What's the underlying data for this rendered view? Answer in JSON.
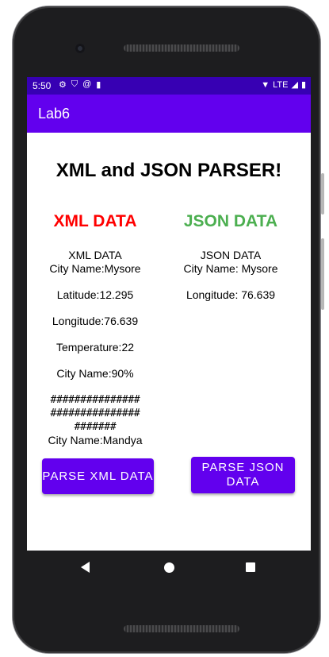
{
  "status_bar": {
    "time": "5:50",
    "network": "LTE"
  },
  "app_bar": {
    "title": "Lab6"
  },
  "main": {
    "title": "XML and JSON PARSER!",
    "xml": {
      "heading": "XML DATA",
      "heading_color": "#ff0000",
      "lines": [
        "XML DATA",
        "City Name:Mysore",
        "Latitude:12.295",
        "Longitude:76.639",
        "Temperature:22",
        "City Name:90%",
        "###############",
        "###############",
        "#######",
        "City Name:Mandya"
      ],
      "button_label": "PARSE XML DATA"
    },
    "json": {
      "heading": "JSON DATA",
      "heading_color": "#4caf50",
      "lines": [
        "JSON DATA",
        "City Name: Mysore",
        "Longitude: 76.639"
      ],
      "button_label": "PARSE JSON DATA"
    }
  },
  "colors": {
    "primary": "#6200ee",
    "primary_dark": "#3700b3"
  },
  "icons": [
    "gear-icon",
    "shield-icon",
    "at-icon",
    "sd-card-icon",
    "wifi-icon",
    "signal-icon",
    "battery-icon",
    "back-icon",
    "home-icon",
    "recents-icon"
  ]
}
